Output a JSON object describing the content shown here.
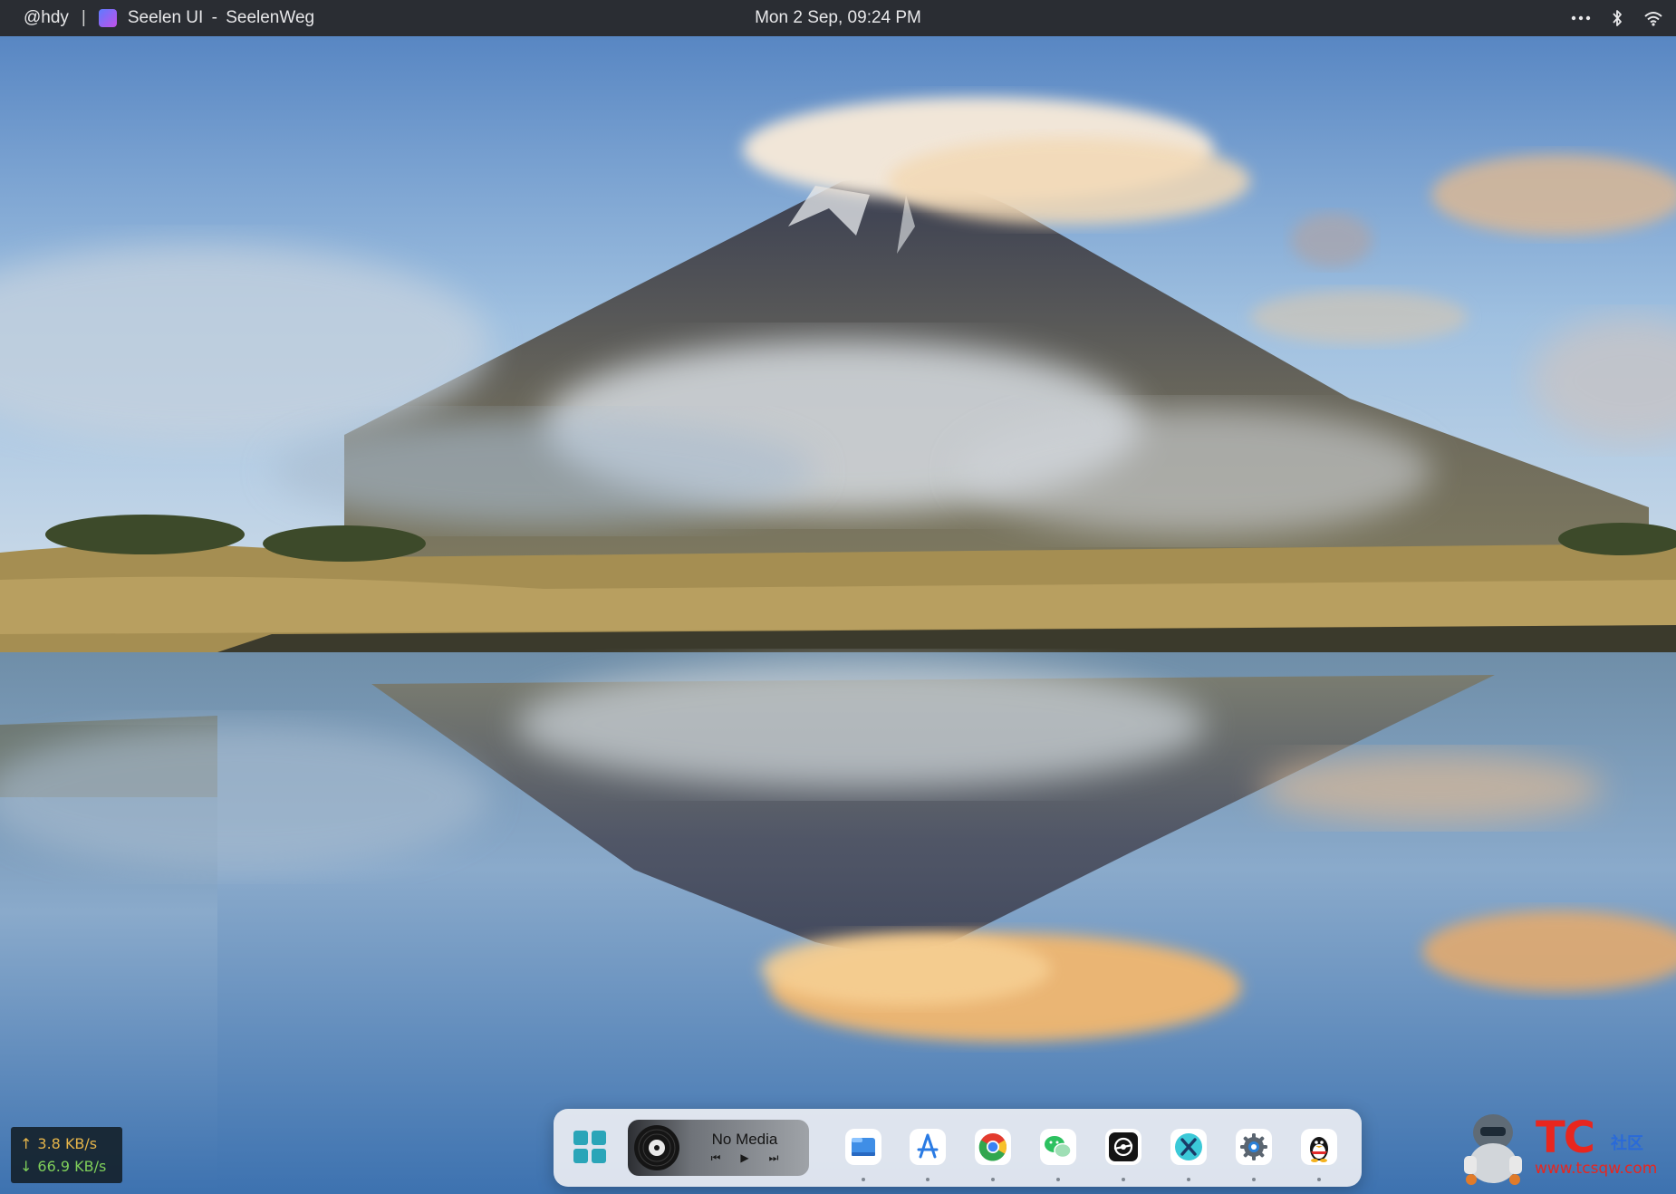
{
  "topbar": {
    "user": "@hdy",
    "separator": "|",
    "app_name": "Seelen UI",
    "title_dash": "-",
    "window_title": "SeelenWeg",
    "datetime": "Mon 2 Sep, 09:24 PM",
    "tray_icons": [
      "more-icon",
      "bluetooth-icon",
      "wifi-icon"
    ]
  },
  "network": {
    "upload_arrow": "↑",
    "upload": "3.8 KB/s",
    "download_arrow": "↓",
    "download": "66.9 KB/s"
  },
  "dock": {
    "media": {
      "label": "No Media",
      "prev": "⏮",
      "play": "▶",
      "next": "⏭"
    },
    "apps": [
      {
        "name": "start-menu",
        "icon": "windows-icon"
      },
      {
        "name": "file-explorer",
        "icon": "folder-icon"
      },
      {
        "name": "app-store",
        "icon": "app-store-icon"
      },
      {
        "name": "chrome",
        "icon": "chrome-icon"
      },
      {
        "name": "wechat",
        "icon": "wechat-icon"
      },
      {
        "name": "steam",
        "icon": "steam-icon"
      },
      {
        "name": "xshell",
        "icon": "x-icon",
        "glyph": "X"
      },
      {
        "name": "settings",
        "icon": "gear-icon"
      },
      {
        "name": "qq",
        "icon": "penguin-icon"
      }
    ]
  },
  "watermark": {
    "logo": "TC",
    "cn": "社区",
    "url": "www.tcsqw.com"
  },
  "colors": {
    "topbar_bg": "#2a2d33",
    "upload": "#e5b44a",
    "download": "#7fcf5a",
    "watermark_red": "#e8261e",
    "watermark_blue": "#2a6ad8"
  }
}
